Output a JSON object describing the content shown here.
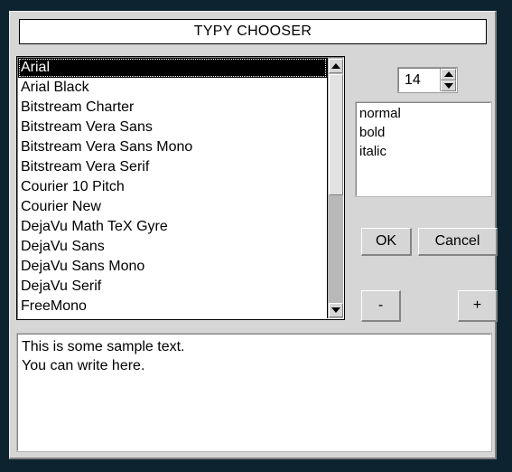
{
  "window": {
    "title": "TYPY CHOOSER"
  },
  "font_list": {
    "selected_index": 0,
    "items": [
      "Arial",
      "Arial Black",
      "Bitstream Charter",
      "Bitstream Vera Sans",
      "Bitstream Vera Sans Mono",
      "Bitstream Vera Serif",
      "Courier 10 Pitch",
      "Courier New",
      "DejaVu Math TeX Gyre",
      "DejaVu Sans",
      "DejaVu Sans Mono",
      "DejaVu Serif",
      "FreeMono"
    ],
    "scrollbar": {
      "up_arrow_icon": "triangle-up-icon",
      "down_arrow_icon": "triangle-down-icon"
    }
  },
  "size_spinner": {
    "value": "14",
    "increment_icon": "triangle-up-icon",
    "decrement_icon": "triangle-down-icon"
  },
  "style_list": {
    "items": [
      "normal",
      "bold",
      "italic"
    ]
  },
  "buttons": {
    "ok": "OK",
    "cancel": "Cancel",
    "minus": "-",
    "plus": "+"
  },
  "sample_text": {
    "lines": [
      "This is some sample text.",
      "You can write here."
    ]
  },
  "colors": {
    "frame": "#0d2430",
    "panel": "#d6d6d6",
    "field": "#ffffff",
    "selection": "#000000",
    "shadow": "#808080"
  }
}
